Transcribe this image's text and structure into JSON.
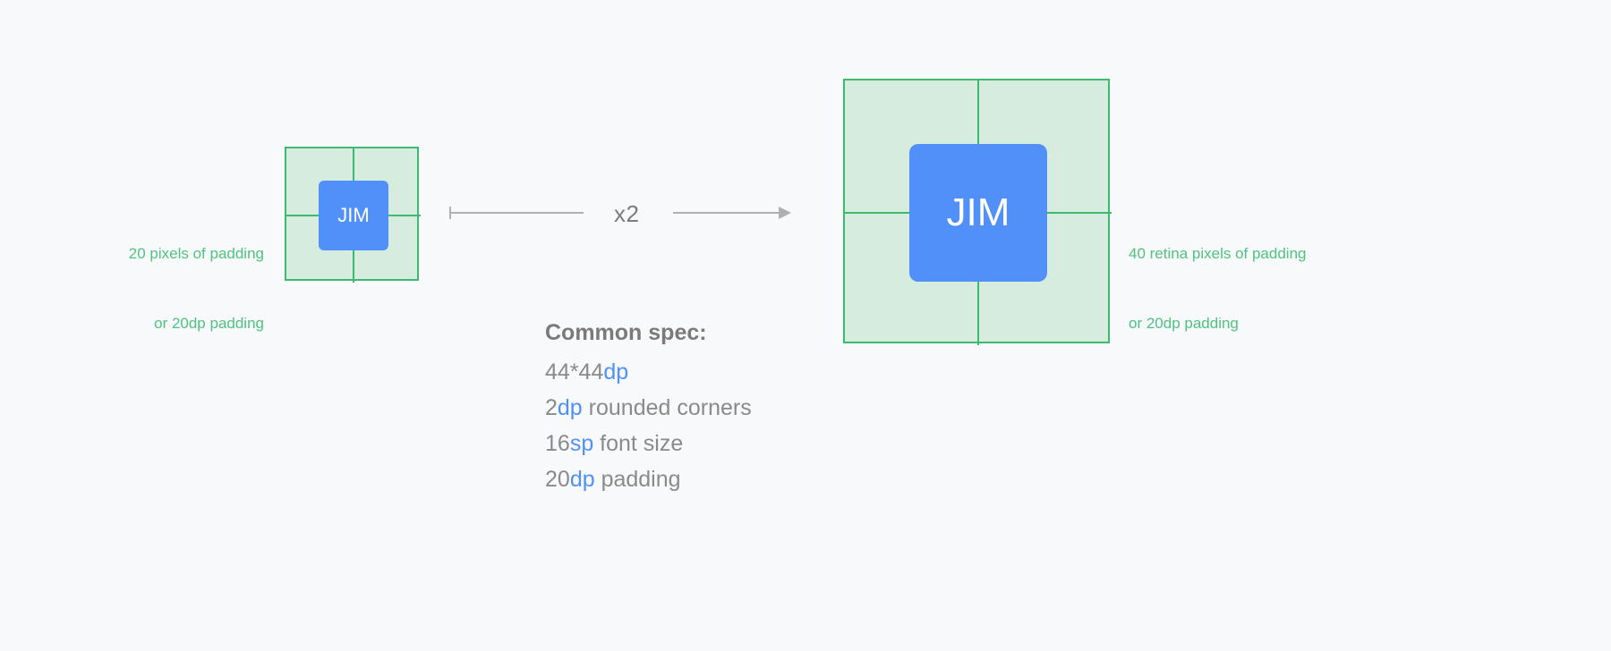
{
  "colors": {
    "background": "#f8f9fa",
    "pad_fill": "#d5ecdf",
    "pad_border": "#3cba6e",
    "button_blue": "#5090f8",
    "annotation_green": "#4fc281",
    "spec_gray": "#8a8a8a",
    "arrow_gray": "#b0b0b0"
  },
  "small_group": {
    "button_label": "JIM",
    "annotation": {
      "line1": "20 pixels of padding",
      "line2": "or 20dp padding"
    }
  },
  "large_group": {
    "button_label": "JIM",
    "annotation": {
      "line1": "40 retina pixels of padding",
      "line2": "or 20dp padding"
    }
  },
  "scale": {
    "multiplier_label": "x2",
    "arrow_icon": "right-arrow-icon"
  },
  "spec": {
    "title": "Common spec:",
    "lines": [
      {
        "value": "44*44",
        "unit": "dp",
        "suffix": ""
      },
      {
        "value": "2",
        "unit": "dp",
        "suffix": " rounded corners"
      },
      {
        "value": "16",
        "unit": "sp",
        "suffix": " font size"
      },
      {
        "value": "20",
        "unit": "dp",
        "suffix": " padding"
      }
    ]
  }
}
